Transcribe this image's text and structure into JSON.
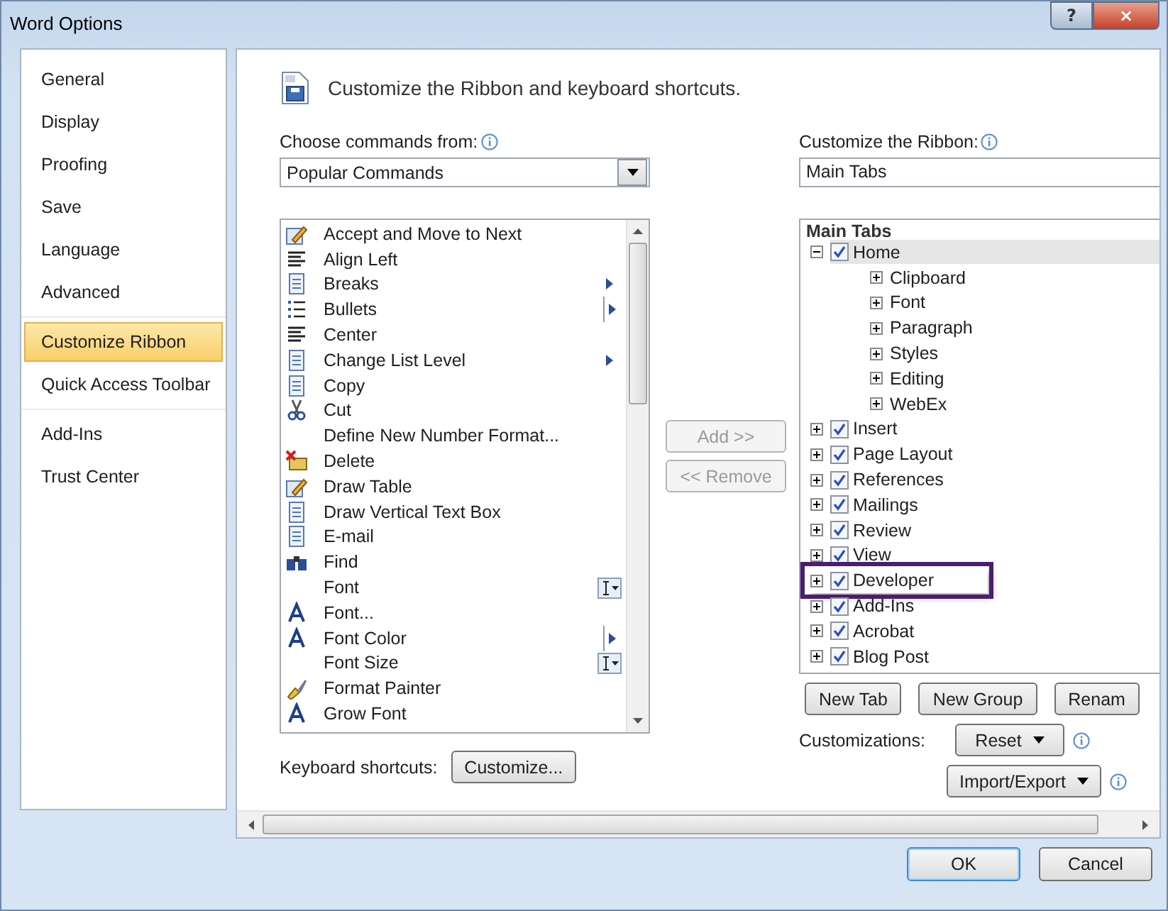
{
  "window": {
    "title": "Word Options",
    "help": "?",
    "close": "×"
  },
  "sidebar": {
    "groups": [
      {
        "items": [
          {
            "label": "General",
            "selected": false
          },
          {
            "label": "Display",
            "selected": false
          },
          {
            "label": "Proofing",
            "selected": false
          },
          {
            "label": "Save",
            "selected": false
          },
          {
            "label": "Language",
            "selected": false
          },
          {
            "label": "Advanced",
            "selected": false
          }
        ]
      },
      {
        "items": [
          {
            "label": "Customize Ribbon",
            "selected": true
          },
          {
            "label": "Quick Access Toolbar",
            "selected": false
          }
        ]
      },
      {
        "items": [
          {
            "label": "Add-Ins",
            "selected": false
          },
          {
            "label": "Trust Center",
            "selected": false
          }
        ]
      }
    ]
  },
  "heading": "Customize the Ribbon and keyboard shortcuts.",
  "commands": {
    "label": "Choose commands from:",
    "value": "Popular Commands",
    "items": [
      {
        "label": "Accept and Move to Next",
        "kind": "plain"
      },
      {
        "label": "Align Left",
        "kind": "plain"
      },
      {
        "label": "Breaks",
        "kind": "submenu"
      },
      {
        "label": "Bullets",
        "kind": "split"
      },
      {
        "label": "Center",
        "kind": "plain"
      },
      {
        "label": "Change List Level",
        "kind": "submenu"
      },
      {
        "label": "Copy",
        "kind": "plain"
      },
      {
        "label": "Cut",
        "kind": "plain"
      },
      {
        "label": "Define New Number Format...",
        "kind": "plain"
      },
      {
        "label": "Delete",
        "kind": "plain"
      },
      {
        "label": "Draw Table",
        "kind": "plain"
      },
      {
        "label": "Draw Vertical Text Box",
        "kind": "plain"
      },
      {
        "label": "E-mail",
        "kind": "plain"
      },
      {
        "label": "Find",
        "kind": "plain"
      },
      {
        "label": "Font",
        "kind": "picker"
      },
      {
        "label": "Font...",
        "kind": "plain"
      },
      {
        "label": "Font Color",
        "kind": "split"
      },
      {
        "label": "Font Size",
        "kind": "picker"
      },
      {
        "label": "Format Painter",
        "kind": "plain"
      },
      {
        "label": "Grow Font",
        "kind": "plain"
      }
    ]
  },
  "add_button": {
    "label": "Add >>",
    "disabled": true
  },
  "remove_button": {
    "label": "<< Remove",
    "disabled": true
  },
  "keyboard": {
    "label": "Keyboard shortcuts:",
    "button": "Customize..."
  },
  "ribbon": {
    "label": "Customize the Ribbon:",
    "value": "Main Tabs",
    "tree_title": "Main Tabs",
    "tabs": [
      {
        "label": "Home",
        "checked": true,
        "expanded": true,
        "selected": true,
        "highlighted": false,
        "children": [
          {
            "label": "Clipboard"
          },
          {
            "label": "Font"
          },
          {
            "label": "Paragraph"
          },
          {
            "label": "Styles"
          },
          {
            "label": "Editing"
          },
          {
            "label": "WebEx"
          }
        ]
      },
      {
        "label": "Insert",
        "checked": true,
        "expanded": false,
        "selected": false,
        "highlighted": false
      },
      {
        "label": "Page Layout",
        "checked": true,
        "expanded": false,
        "selected": false,
        "highlighted": false
      },
      {
        "label": "References",
        "checked": true,
        "expanded": false,
        "selected": false,
        "highlighted": false
      },
      {
        "label": "Mailings",
        "checked": true,
        "expanded": false,
        "selected": false,
        "highlighted": false
      },
      {
        "label": "Review",
        "checked": true,
        "expanded": false,
        "selected": false,
        "highlighted": false
      },
      {
        "label": "View",
        "checked": true,
        "expanded": false,
        "selected": false,
        "highlighted": false
      },
      {
        "label": "Developer",
        "checked": true,
        "expanded": false,
        "selected": false,
        "highlighted": true
      },
      {
        "label": "Add-Ins",
        "checked": true,
        "expanded": false,
        "selected": false,
        "highlighted": false
      },
      {
        "label": "Acrobat",
        "checked": true,
        "expanded": false,
        "selected": false,
        "highlighted": false
      },
      {
        "label": "Blog Post",
        "checked": true,
        "expanded": false,
        "selected": false,
        "highlighted": false
      }
    ],
    "buttons": [
      "New Tab",
      "New Group",
      "Renam"
    ],
    "customizations_label": "Customizations:",
    "reset": "Reset",
    "import_export": "Import/Export"
  },
  "footer": {
    "ok": "OK",
    "cancel": "Cancel"
  }
}
